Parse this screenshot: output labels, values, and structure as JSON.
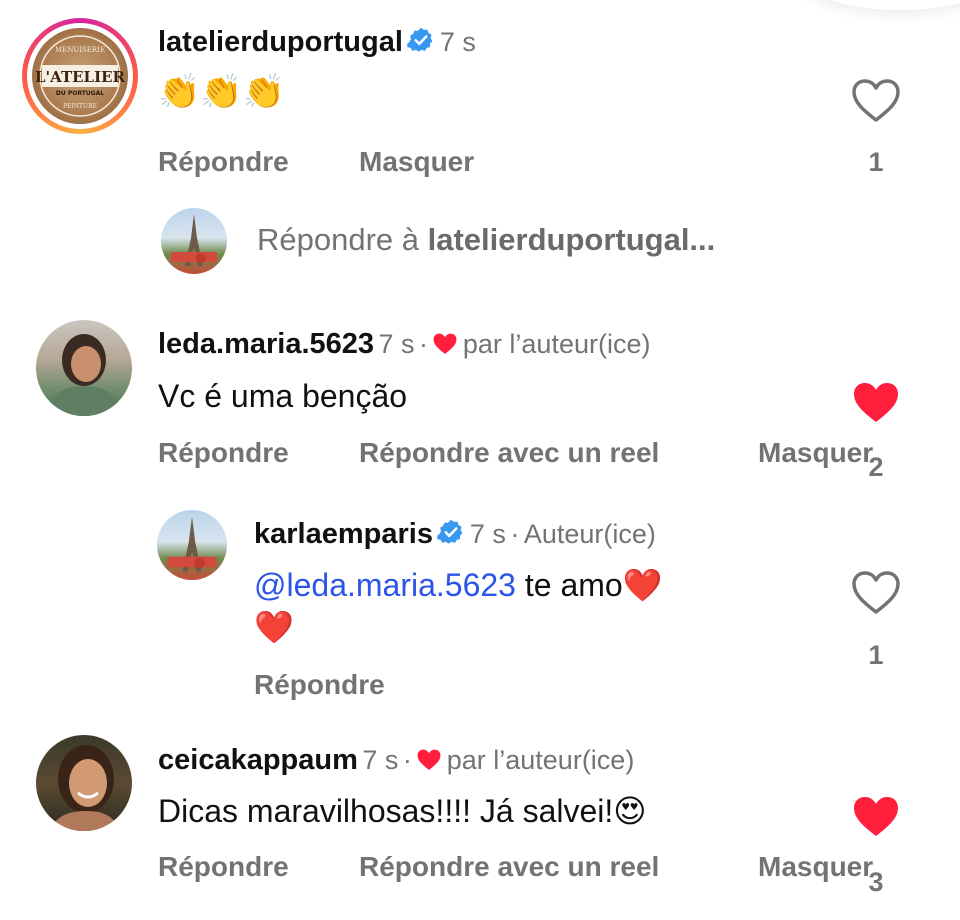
{
  "comments": [
    {
      "username": "latelierduportugal",
      "verified": true,
      "time": "7 s",
      "text": "👏👏👏",
      "likes": "1",
      "liked": false,
      "actions": [
        "Répondre",
        "Masquer"
      ],
      "logo": {
        "top": "MENUISERIE",
        "main": "L'ATELIER",
        "sub": "DU PORTUGAL",
        "bottom": "PEINTURE"
      }
    },
    {
      "username": "leda.maria.5623",
      "time": "7 s",
      "author_liked": "par l’auteur(ice)",
      "text": "Vc é uma benção",
      "likes": "2",
      "liked": true,
      "actions": [
        "Répondre",
        "Répondre avec un reel",
        "Masquer"
      ]
    },
    {
      "username": "ceicakappaum",
      "time": "7 s",
      "author_liked": "par l’auteur(ice)",
      "text": "Dicas maravilhosas!!!! Já salvei!😍",
      "likes": "3",
      "liked": true,
      "actions": [
        "Répondre",
        "Répondre avec un reel",
        "Masquer"
      ]
    }
  ],
  "reply_prompt": {
    "prefix": "Répondre à ",
    "target": "latelierduportugal..."
  },
  "reply": {
    "username": "karlaemparis",
    "verified": true,
    "time": "7 s",
    "badge": "Auteur(ice)",
    "mention": "@leda.maria.5623",
    "text": " te amo❤️",
    "text2": "❤️",
    "likes": "1",
    "liked": false,
    "action": "Répondre"
  },
  "colors": {
    "liked_heart": "#ff1f3d",
    "verified": "#3897f0",
    "mention": "#2b55e6",
    "secondary_text": "#737373"
  },
  "icons": [
    "heart-outline-icon",
    "heart-filled-icon",
    "verified-badge-icon",
    "small-heart-icon"
  ]
}
